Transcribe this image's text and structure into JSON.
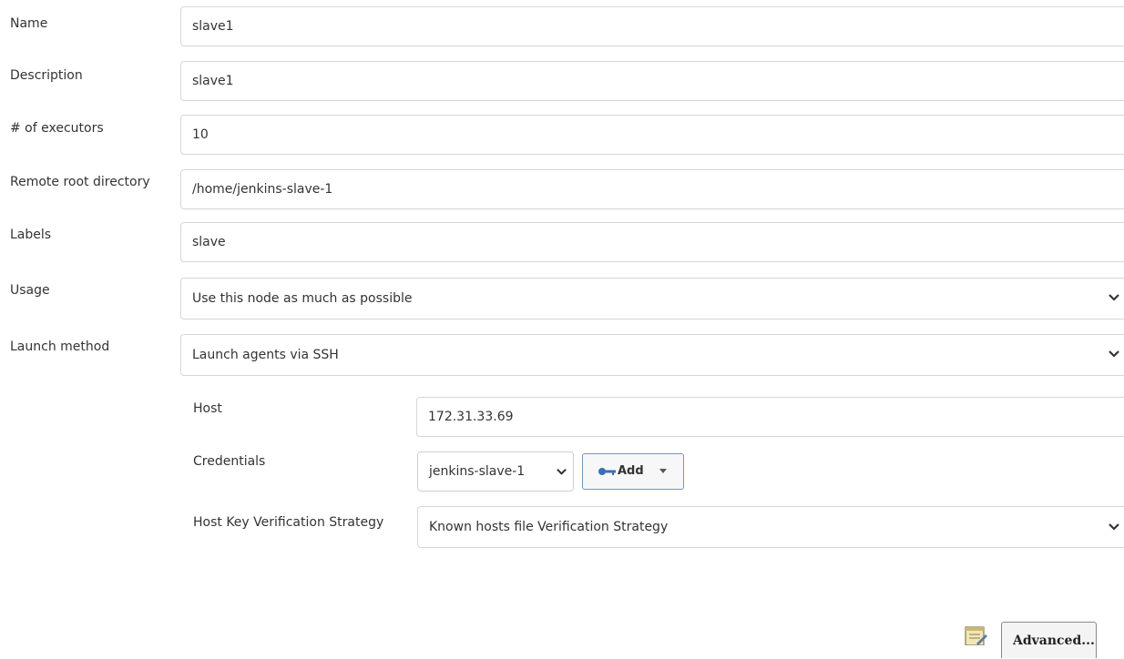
{
  "form": {
    "name": {
      "label": "Name",
      "value": "slave1"
    },
    "description": {
      "label": "Description",
      "value": "slave1"
    },
    "executors": {
      "label": "# of executors",
      "value": "10"
    },
    "remote_root": {
      "label": "Remote root directory",
      "value": "/home/jenkins-slave-1"
    },
    "labels": {
      "label": "Labels",
      "value": "slave"
    },
    "usage": {
      "label": "Usage",
      "selected": "Use this node as much as possible"
    },
    "launch_method": {
      "label": "Launch method",
      "selected": "Launch agents via SSH"
    }
  },
  "ssh": {
    "host": {
      "label": "Host",
      "value": "172.31.33.69"
    },
    "credentials": {
      "label": "Credentials",
      "selected": "jenkins-slave-1",
      "add_label": "Add"
    },
    "host_key": {
      "label": "Host Key Verification Strategy",
      "selected": "Known hosts file Verification Strategy"
    }
  },
  "footer": {
    "advanced_label": "Advanced..."
  },
  "icons": {
    "dropdown": "chevron-down-icon",
    "add": "key-icon",
    "add_caret": "caret-down-icon",
    "notepad": "notepad-icon"
  },
  "colors": {
    "border": "#d6d6d6",
    "add_border": "#7a95b4",
    "key_blue": "#3b6fb6"
  }
}
